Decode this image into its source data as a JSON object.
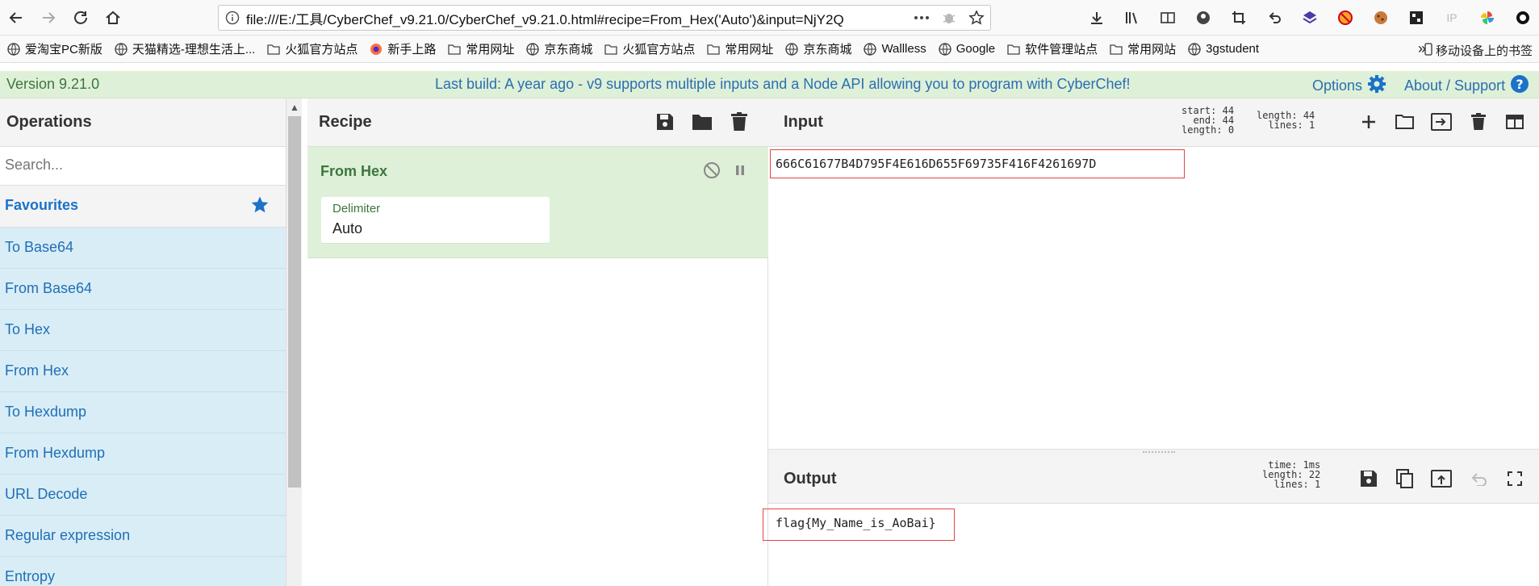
{
  "browser": {
    "url": "file:///E:/工具/CyberChef_v9.21.0/CyberChef_v9.21.0.html#recipe=From_Hex('Auto')&input=NjY2Q",
    "bookmarks": [
      "爱淘宝PC新版",
      "天猫精选-理想生活上...",
      "火狐官方站点",
      "新手上路",
      "常用网址",
      "京东商城",
      "火狐官方站点",
      "常用网址",
      "京东商城",
      "Wallless",
      "Google",
      "软件管理站点",
      "常用网站",
      "3gstudent"
    ],
    "bookmarks_more": "»",
    "mobile_bookmarks": "移动设备上的书签",
    "ip_label": "IP"
  },
  "banner": {
    "version": "Version 9.21.0",
    "notice": "Last build: A year ago - v9 supports multiple inputs and a Node API allowing you to program with CyberChef!",
    "options": "Options",
    "about": "About / Support",
    "accent": "#dff0d8"
  },
  "operations": {
    "title": "Operations",
    "search_placeholder": "Search...",
    "favourites": "Favourites",
    "items": [
      "To Base64",
      "From Base64",
      "To Hex",
      "From Hex",
      "To Hexdump",
      "From Hexdump",
      "URL Decode",
      "Regular expression",
      "Entropy"
    ]
  },
  "recipe": {
    "title": "Recipe",
    "operation": {
      "name": "From Hex",
      "arg_label": "Delimiter",
      "arg_value": "Auto"
    }
  },
  "input": {
    "title": "Input",
    "stats": {
      "start_label": "start:",
      "start": "44",
      "end_label": "end:",
      "end": "44",
      "length_label": "length:",
      "length": "0",
      "total_length_label": "length:",
      "total_length": "44",
      "lines_label": "lines:",
      "lines": "1"
    },
    "text": "666C61677B4D795F4E616D655F69735F416F4261697D"
  },
  "output": {
    "title": "Output",
    "stats": {
      "time_label": "time:",
      "time": "1ms",
      "length_label": "length:",
      "length": "22",
      "lines_label": "lines:",
      "lines": "1"
    },
    "text": "flag{My_Name_is_AoBai}"
  }
}
